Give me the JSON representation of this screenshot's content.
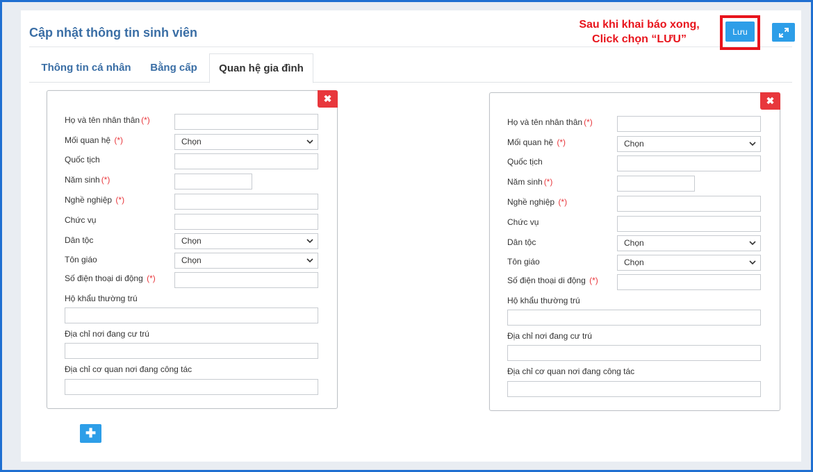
{
  "header": {
    "title": "Cập nhật thông tin sinh viên",
    "annotation_line1": "Sau khi khai báo xong,",
    "annotation_line2": "Click chọn  “LƯU”",
    "save_label": "Lưu",
    "expand_icon": "expand-arrows-icon",
    "annotation_color": "#e8141c",
    "accent_color": "#2d9ee8"
  },
  "tabs": [
    {
      "label": "Thông tin cá nhân",
      "active": false
    },
    {
      "label": "Bằng cấp",
      "active": false
    },
    {
      "label": "Quan hệ gia đình",
      "active": true
    }
  ],
  "form": {
    "required_mark": "(*)",
    "labels": {
      "full_name": "Họ và tên nhân thân",
      "relationship": "Mối quan hệ",
      "nationality": "Quốc tịch",
      "birth_year": "Năm sinh",
      "occupation": "Nghề nghiệp",
      "position": "Chức vụ",
      "ethnicity": "Dân tộc",
      "religion": "Tôn giáo",
      "mobile_phone": "Số điện thoại di động",
      "permanent_address": "Hộ khẩu thường trú",
      "current_address": "Địa chỉ nơi đang cư trú",
      "work_address": "Địa chỉ cơ quan nơi đang công tác"
    },
    "select_placeholder": "Chọn"
  },
  "members": [
    {
      "full_name": "",
      "relationship": "Chọn",
      "nationality": "",
      "birth_year": "",
      "occupation": "",
      "position": "",
      "ethnicity": "Chọn",
      "religion": "Chọn",
      "mobile_phone": "",
      "permanent_address": "",
      "current_address": "",
      "work_address": ""
    },
    {
      "full_name": "",
      "relationship": "Chọn",
      "nationality": "",
      "birth_year": "",
      "occupation": "",
      "position": "",
      "ethnicity": "Chọn",
      "religion": "Chọn",
      "mobile_phone": "",
      "permanent_address": "",
      "current_address": "",
      "work_address": ""
    }
  ],
  "actions": {
    "remove_label": "✖",
    "add_label": "✚"
  }
}
